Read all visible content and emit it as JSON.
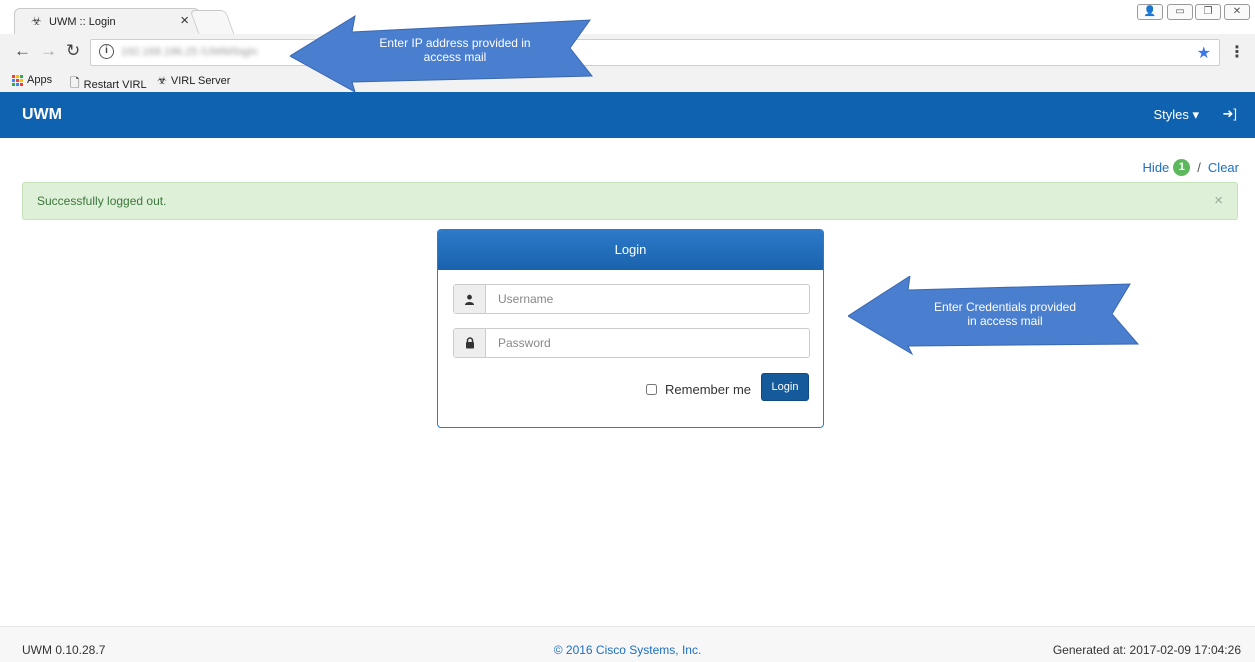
{
  "browser": {
    "tab": {
      "title": "UWM :: Login",
      "close": "×"
    },
    "url_blurred": "192.168.196.25 /UWM/login",
    "bookmarks": [
      {
        "label": "Apps"
      },
      {
        "label": "Restart VIRL"
      },
      {
        "label": "VIRL Server"
      }
    ]
  },
  "app": {
    "brand": "UWM",
    "styles_label": "Styles ▾",
    "signin_icon": "➜]"
  },
  "notices": {
    "hide_label": "Hide",
    "count": "1",
    "sep": "/",
    "clear_label": "Clear"
  },
  "alert": {
    "message": "Successfully logged out.",
    "close": "×"
  },
  "login": {
    "heading": "Login",
    "username_placeholder": "Username",
    "password_placeholder": "Password",
    "remember_label": "Remember me",
    "button_label": "Login"
  },
  "annotations": {
    "ip_line1": "Enter IP address provided in",
    "ip_line2": "access mail",
    "cred_line1": "Enter Credentials provided",
    "cred_line2": "in access mail"
  },
  "footer": {
    "version": "UWM 0.10.28.7",
    "copyright": "© 2016 Cisco Systems, Inc.",
    "generated": "Generated at: 2017-02-09 17:04:26"
  },
  "colors": {
    "appbar": "#0f62b0",
    "alert_bg": "#dff0d8",
    "callout": "#4a7ecf",
    "badge": "#5cb85c"
  }
}
